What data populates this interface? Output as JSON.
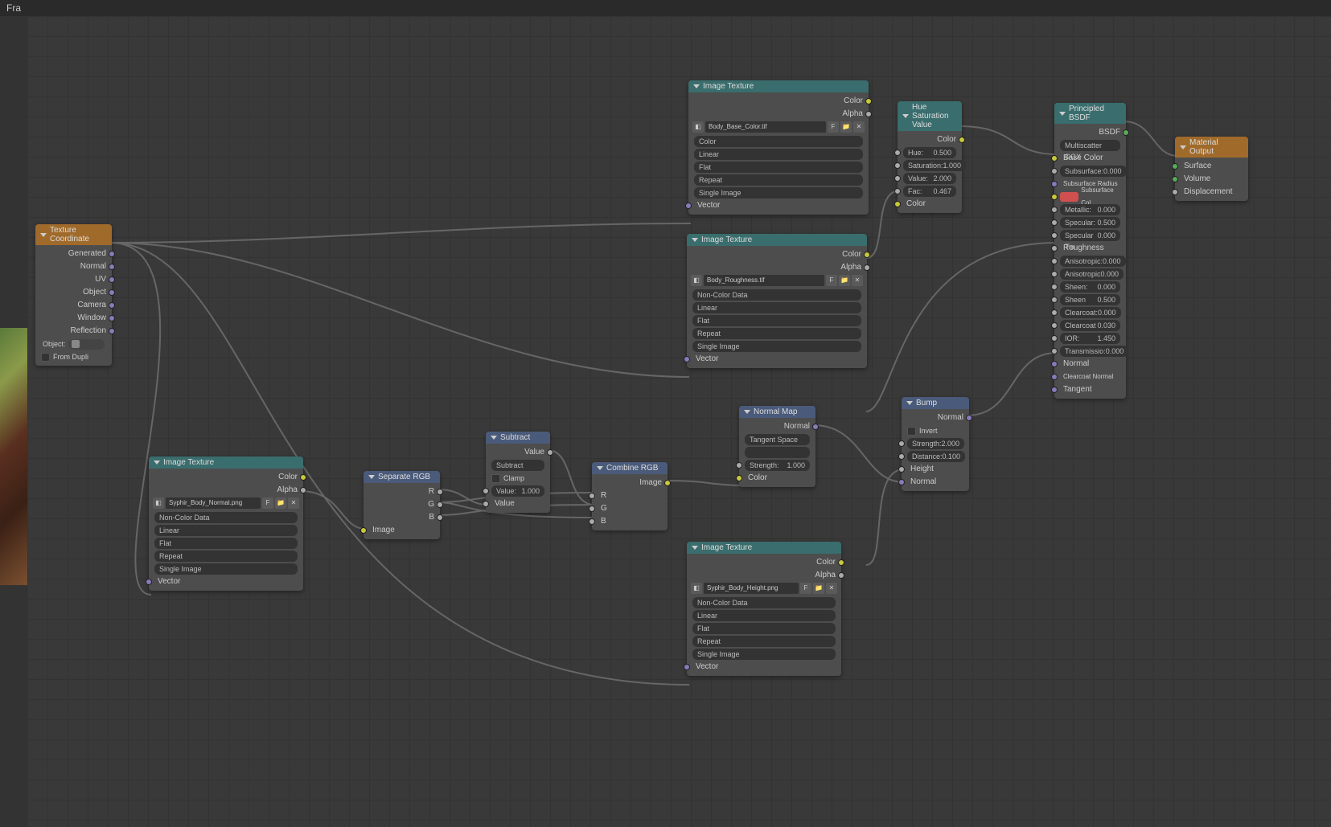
{
  "topbar": {
    "text": "Fra"
  },
  "topbuttons": [
    "+",
    "+",
    "+"
  ],
  "texcoord": {
    "title": "Texture Coordinate",
    "out_generated": "Generated",
    "out_normal": "Normal",
    "out_uv": "UV",
    "out_object": "Object",
    "out_camera": "Camera",
    "out_window": "Window",
    "out_reflection": "Reflection",
    "object_label": "Object:",
    "from_dupli": "From Dupli"
  },
  "imgtex1": {
    "title": "Image Texture",
    "out_color": "Color",
    "out_alpha": "Alpha",
    "image_name": "Body_Base_Color.tif",
    "f_btn": "F",
    "opt_colorspace": "Color",
    "opt_interp": "Linear",
    "opt_proj": "Flat",
    "opt_ext": "Repeat",
    "opt_source": "Single Image",
    "in_vector": "Vector"
  },
  "imgtex2": {
    "title": "Image Texture",
    "out_color": "Color",
    "out_alpha": "Alpha",
    "image_name": "Body_Roughness.tif",
    "f_btn": "F",
    "opt_colorspace": "Non-Color Data",
    "opt_interp": "Linear",
    "opt_proj": "Flat",
    "opt_ext": "Repeat",
    "opt_source": "Single Image",
    "in_vector": "Vector"
  },
  "imgtex3": {
    "title": "Image Texture",
    "out_color": "Color",
    "out_alpha": "Alpha",
    "image_name": "Syphir_Body_Normal.png",
    "f_btn": "F",
    "opt_colorspace": "Non-Color Data",
    "opt_interp": "Linear",
    "opt_proj": "Flat",
    "opt_ext": "Repeat",
    "opt_source": "Single Image",
    "in_vector": "Vector"
  },
  "imgtex4": {
    "title": "Image Texture",
    "out_color": "Color",
    "out_alpha": "Alpha",
    "image_name": "Syphir_Body_Height.png",
    "f_btn": "F",
    "opt_colorspace": "Non-Color Data",
    "opt_interp": "Linear",
    "opt_proj": "Flat",
    "opt_ext": "Repeat",
    "opt_source": "Single Image",
    "in_vector": "Vector"
  },
  "seprgb": {
    "title": "Separate RGB",
    "out_r": "R",
    "out_g": "G",
    "out_b": "B",
    "in_image": "Image"
  },
  "subtract": {
    "title": "Subtract",
    "out_value": "Value",
    "op": "Subtract",
    "clamp": "Clamp",
    "value_label": "Value:",
    "value_num": "1.000",
    "in_value": "Value"
  },
  "combinergb": {
    "title": "Combine RGB",
    "out_image": "Image",
    "in_r": "R",
    "in_g": "G",
    "in_b": "B"
  },
  "normalmap": {
    "title": "Normal Map",
    "out_normal": "Normal",
    "space": "Tangent Space",
    "uvmap_field": "",
    "strength_label": "Strength:",
    "strength_val": "1.000",
    "in_color": "Color"
  },
  "huesat": {
    "title": "Hue Saturation Value",
    "out_color": "Color",
    "hue_label": "Hue:",
    "hue_val": "0.500",
    "sat_label": "Saturation:",
    "sat_val": "1.000",
    "val_label": "Value:",
    "val_val": "2.000",
    "fac_label": "Fac:",
    "fac_val": "0.467",
    "in_color": "Color"
  },
  "bump": {
    "title": "Bump",
    "out_normal": "Normal",
    "invert": "Invert",
    "strength_label": "Strength:",
    "strength_val": "2.000",
    "dist_label": "Distance:",
    "dist_val": "0.100",
    "in_height": "Height",
    "in_normal": "Normal"
  },
  "principled": {
    "title": "Principled BSDF",
    "out_bsdf": "BSDF",
    "dist": "Multiscatter GGX",
    "base_color": "Base Color",
    "subsurface_label": "Subsurface:",
    "subsurface_val": "0.000",
    "subsurface_radius": "Subsurface Radius",
    "subsurface_col": "Subsurface Col",
    "metallic_label": "Metallic:",
    "metallic_val": "0.000",
    "specular_label": "Specular:",
    "specular_val": "0.500",
    "spectint_label": "Specular Tin",
    "spectint_val": "0.000",
    "roughness": "Roughness",
    "aniso_label": "Anisotropic:",
    "aniso_val": "0.000",
    "anisorot_label": "Anisotropic R",
    "anisorot_val": "0.000",
    "sheen_label": "Sheen:",
    "sheen_val": "0.000",
    "sheentint_label": "Sheen Tint:",
    "sheentint_val": "0.500",
    "clearcoat_label": "Clearcoat:",
    "clearcoat_val": "0.000",
    "clearcoatrough_label": "Clearcoat Ro",
    "clearcoatrough_val": "0.030",
    "ior_label": "IOR:",
    "ior_val": "1.450",
    "transmission_label": "Transmissio:",
    "transmission_val": "0.000",
    "normal": "Normal",
    "clearcoat_normal": "Clearcoat Normal",
    "tangent": "Tangent"
  },
  "matout": {
    "title": "Material Output",
    "in_surface": "Surface",
    "in_volume": "Volume",
    "in_disp": "Displacement"
  }
}
